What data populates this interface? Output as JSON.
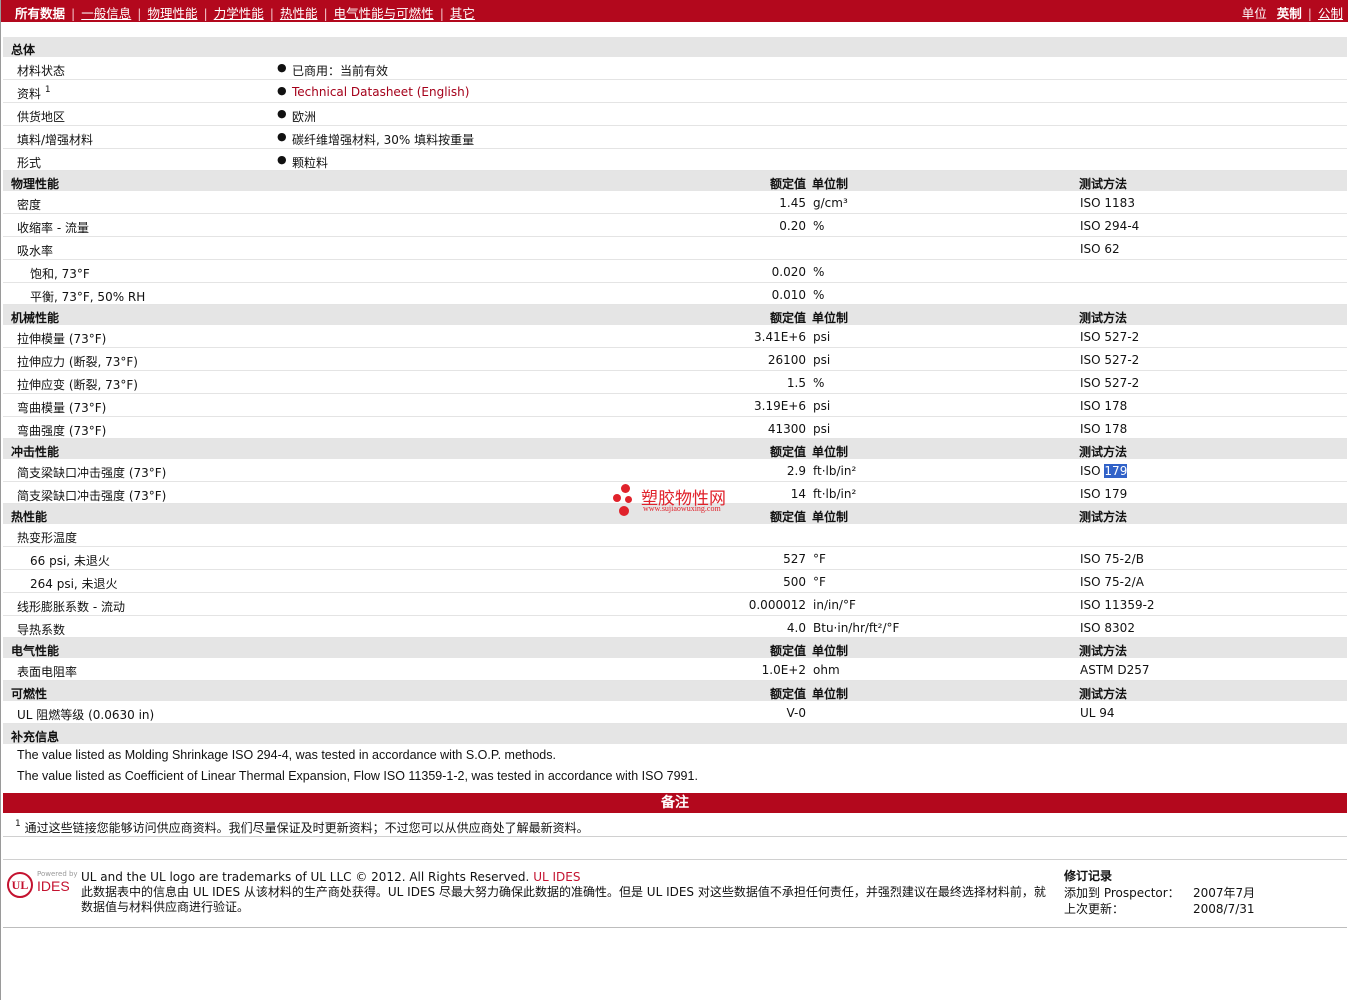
{
  "nav": {
    "items": [
      "所有数据",
      "一般信息",
      "物理性能",
      "力学性能",
      "热性能",
      "电气性能与可燃性",
      "其它"
    ],
    "units_label": "单位",
    "units_english": "英制",
    "units_metric": "公制"
  },
  "headers": {
    "value": "额定值",
    "unit": "单位制",
    "method": "测试方法"
  },
  "general": {
    "title": "总体",
    "rows": [
      {
        "label": "材料状态",
        "value": "已商用：当前有效"
      },
      {
        "label": "资料",
        "sup": "1",
        "value": "Technical Datasheet (English)"
      },
      {
        "label": "供货地区",
        "value": "欧洲"
      },
      {
        "label": "填料/增强材料",
        "value": "碳纤维增强材料, 30% 填料按重量"
      },
      {
        "label": "形式",
        "value": "颗粒料"
      }
    ]
  },
  "physical": {
    "title": "物理性能",
    "rows": [
      {
        "label": "密度",
        "value": "1.45",
        "unit": "g/cm³",
        "method": "ISO 1183"
      },
      {
        "label": "收缩率 - 流量",
        "value": "0.20",
        "unit": "%",
        "method": "ISO 294-4"
      },
      {
        "label": "吸水率",
        "value": "",
        "unit": "",
        "method": "ISO 62"
      },
      {
        "label": "饱和, 73°F",
        "value": "0.020",
        "unit": "%",
        "method": ""
      },
      {
        "label": "平衡, 73°F, 50% RH",
        "value": "0.010",
        "unit": "%",
        "method": ""
      }
    ]
  },
  "mechanical": {
    "title": "机械性能",
    "rows": [
      {
        "label": "拉伸模量 (73°F)",
        "value": "3.41E+6",
        "unit": "psi",
        "method": "ISO 527-2"
      },
      {
        "label": "拉伸应力 (断裂, 73°F)",
        "value": "26100",
        "unit": "psi",
        "method": "ISO 527-2"
      },
      {
        "label": "拉伸应变 (断裂, 73°F)",
        "value": "1.5",
        "unit": "%",
        "method": "ISO 527-2"
      },
      {
        "label": "弯曲模量 (73°F)",
        "value": "3.19E+6",
        "unit": "psi",
        "method": "ISO 178"
      },
      {
        "label": "弯曲强度 (73°F)",
        "value": "41300",
        "unit": "psi",
        "method": "ISO 178"
      }
    ]
  },
  "impact": {
    "title": "冲击性能",
    "rows": [
      {
        "label": "简支梁缺口冲击强度 (73°F)",
        "value": "2.9",
        "unit": "ft·lb/in²",
        "method_prefix": "ISO ",
        "method_selected": "179"
      },
      {
        "label": "简支梁缺口冲击强度 (73°F)",
        "value": "14",
        "unit": "ft·lb/in²",
        "method": "ISO 179"
      }
    ]
  },
  "thermal": {
    "title": "热性能",
    "rows": [
      {
        "label": "热变形温度",
        "value": "",
        "unit": "",
        "method": ""
      },
      {
        "label": "66 psi, 未退火",
        "value": "527",
        "unit": "°F",
        "method": "ISO 75-2/B"
      },
      {
        "label": "264 psi, 未退火",
        "value": "500",
        "unit": "°F",
        "method": "ISO 75-2/A"
      },
      {
        "label": "线形膨胀系数 - 流动",
        "value": "0.000012",
        "unit": "in/in/°F",
        "method": "ISO 11359-2"
      },
      {
        "label": "导热系数",
        "value": "4.0",
        "unit": "Btu·in/hr/ft²/°F",
        "method": "ISO 8302"
      }
    ]
  },
  "electrical": {
    "title": "电气性能",
    "rows": [
      {
        "label": "表面电阻率",
        "value": "1.0E+2",
        "unit": "ohm",
        "method": "ASTM D257"
      }
    ]
  },
  "flammability": {
    "title": "可燃性",
    "rows": [
      {
        "label": "UL 阻燃等级 (0.0630 in)",
        "value": "V-0",
        "unit": "",
        "method": "UL 94"
      }
    ]
  },
  "supplement": {
    "title": "补充信息",
    "notes": [
      "The value listed as Molding Shrinkage ISO 294-4, was tested in accordance with S.O.P. methods.",
      "The value listed as Coefficient of Linear Thermal Expansion, Flow ISO 11359-1-2, was tested in accordance with ISO 7991."
    ]
  },
  "remarks": {
    "title": "备注",
    "footnote_sup": "1",
    "footnote": "通过这些链接您能够访问供应商资料。我们尽量保证及时更新资料；不过您可以从供应商处了解最新资料。"
  },
  "footer": {
    "logo_ul": "UL",
    "logo_powered": "Powered by",
    "logo_ides": "IDES",
    "trademark": "UL and the UL logo are trademarks of UL LLC © 2012. All Rights Reserved.",
    "ides_link": "UL IDES",
    "disclaimer": "此数据表中的信息由 UL IDES 从该材料的生产商处获得。UL IDES 尽最大努力确保此数据的准确性。但是 UL IDES 对这些数据值不承担任何责任，并强烈建议在最终选择材料前，就数据值与材料供应商进行验证。",
    "revision_title": "修订记录",
    "added_label": "添加到 Prospector：",
    "added_value": "2007年7月",
    "updated_label": "上次更新：",
    "updated_value": "2008/7/31"
  },
  "watermark": {
    "name": "塑胶物性网",
    "url": "www.sujiaowuxing.com"
  },
  "colors": {
    "brand_red": "#b3081d",
    "section_gray": "#e5e5e5",
    "link_red": "#a4001a",
    "selection_blue": "#3162c8"
  }
}
